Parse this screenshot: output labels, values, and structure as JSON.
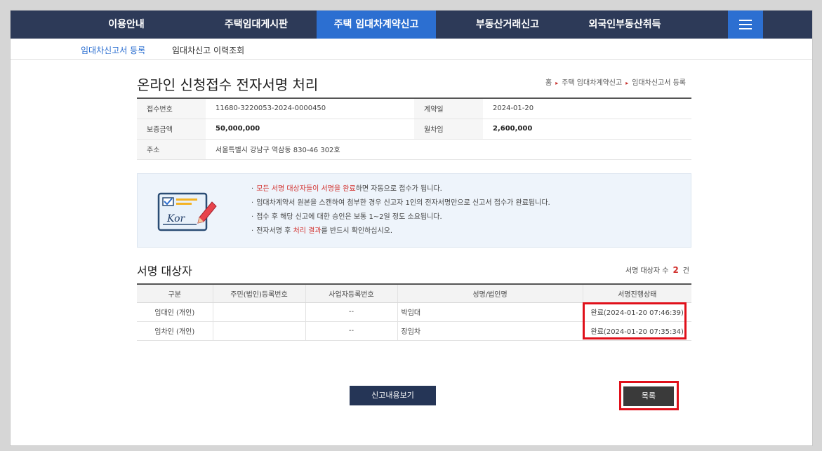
{
  "gnb": {
    "items": [
      "이용안내",
      "주택임대게시판",
      "주택 임대차계약신고",
      "부동산거래신고",
      "외국인부동산취득"
    ],
    "active_index": 2,
    "menu_icon": "hamburger-icon"
  },
  "sub_nav": {
    "items": [
      "임대차신고서 등록",
      "임대차신고 이력조회"
    ],
    "active_index": 0
  },
  "page": {
    "title": "온라인 신청접수 전자서명 처리",
    "breadcrumb": [
      "홈",
      "주택 임대차계약신고",
      "임대차신고서 등록"
    ]
  },
  "info": {
    "receipt_no_label": "접수번호",
    "receipt_no": "11680-3220053-2024-0000450",
    "contract_date_label": "계약일",
    "contract_date": "2024-01-20",
    "deposit_label": "보증금액",
    "deposit": "50,000,000",
    "monthly_rent_label": "월차임",
    "monthly_rent": "2,600,000",
    "address_label": "주소",
    "address": "서울특별시 강남구 역삼동 830-46 302호"
  },
  "notice": {
    "icon": "signed-card-icon",
    "icon_text": "Kor",
    "bullet": "·",
    "line1_highlight": "모든 서명 대상자들이 서명을 완료",
    "line1_rest": "하면 자동으로 접수가 됩니다.",
    "line2": "임대차계약서 원본을 스캔하여 첨부한 경우 신고자 1인의 전자서명만으로 신고서 접수가 완료됩니다.",
    "line3": "접수 후 해당 신고에 대한 승인은 보통 1~2일 정도 소요됩니다.",
    "line4_before": "전자서명 후 ",
    "line4_highlight": "처리 결과",
    "line4_after": "를 반드시 확인하십시오."
  },
  "signers": {
    "title": "서명 대상자",
    "count_label": "서명 대상자 수",
    "count": "2",
    "count_unit": "건",
    "columns": [
      "구분",
      "주민(법인)등록번호",
      "사업자등록번호",
      "성명/법인명",
      "서명진행상태"
    ],
    "rows": [
      {
        "type": "임대인 (개인)",
        "resident_no": "",
        "business_no": "--",
        "name": "박임대",
        "status": "완료(2024-01-20 07:46:39)"
      },
      {
        "type": "임차인 (개인)",
        "resident_no": "",
        "business_no": "--",
        "name": "장임차",
        "status": "완료(2024-01-20 07:35:34)"
      }
    ]
  },
  "buttons": {
    "view": "신고내용보기",
    "list": "목록"
  },
  "colors": {
    "nav_bg": "#2d3a58",
    "nav_active": "#2c6fd1",
    "accent_red": "#d2312e",
    "highlight_box": "#e0101a",
    "view_button": "#253556",
    "list_button": "#3a3a3a"
  }
}
